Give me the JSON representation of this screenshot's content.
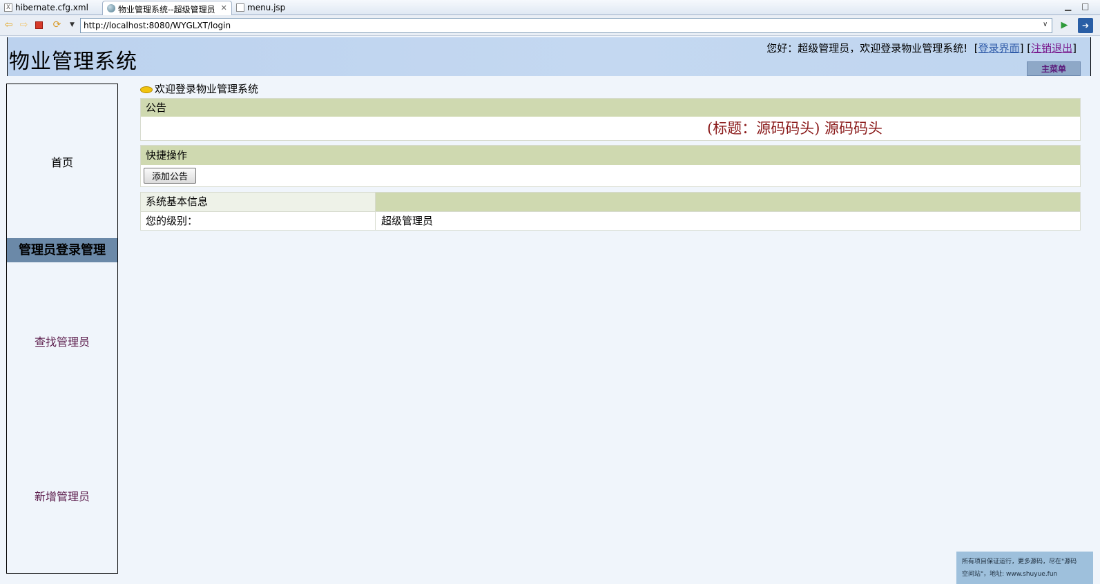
{
  "editor_tabs": [
    {
      "label": "hibernate.cfg.xml",
      "icon": "xml-file-icon"
    },
    {
      "label": "物业管理系统--超级管理员",
      "icon": "globe-icon"
    },
    {
      "label": "menu.jsp",
      "icon": "jsp-file-icon"
    }
  ],
  "browser": {
    "url": "http://localhost:8080/WYGLXT/login"
  },
  "header": {
    "title": "物业管理系统",
    "greeting": "您好：超级管理员，欢迎登录物业管理系统!",
    "login_link": "登录界面",
    "logout_link": "注销退出",
    "main_menu": "主菜单"
  },
  "sidebar": {
    "home": "首页",
    "section": "管理员登录管理",
    "find": "查找管理员",
    "add": "新增管理员"
  },
  "main": {
    "welcome": "欢迎登录物业管理系统",
    "notice": {
      "heading": "公告",
      "content": "(标题：源码码头) 源码码头"
    },
    "quick": {
      "heading": "快捷操作",
      "add_notice": "添加公告"
    },
    "info": {
      "heading": "系统基本信息",
      "level_label": "您的级别：",
      "level_value": "超级管理员"
    }
  },
  "watermark": {
    "line1": "所有项目保证运行，更多源码，尽在\"源码",
    "line2": "空间站\"，地址: www.shuyue.fun"
  }
}
